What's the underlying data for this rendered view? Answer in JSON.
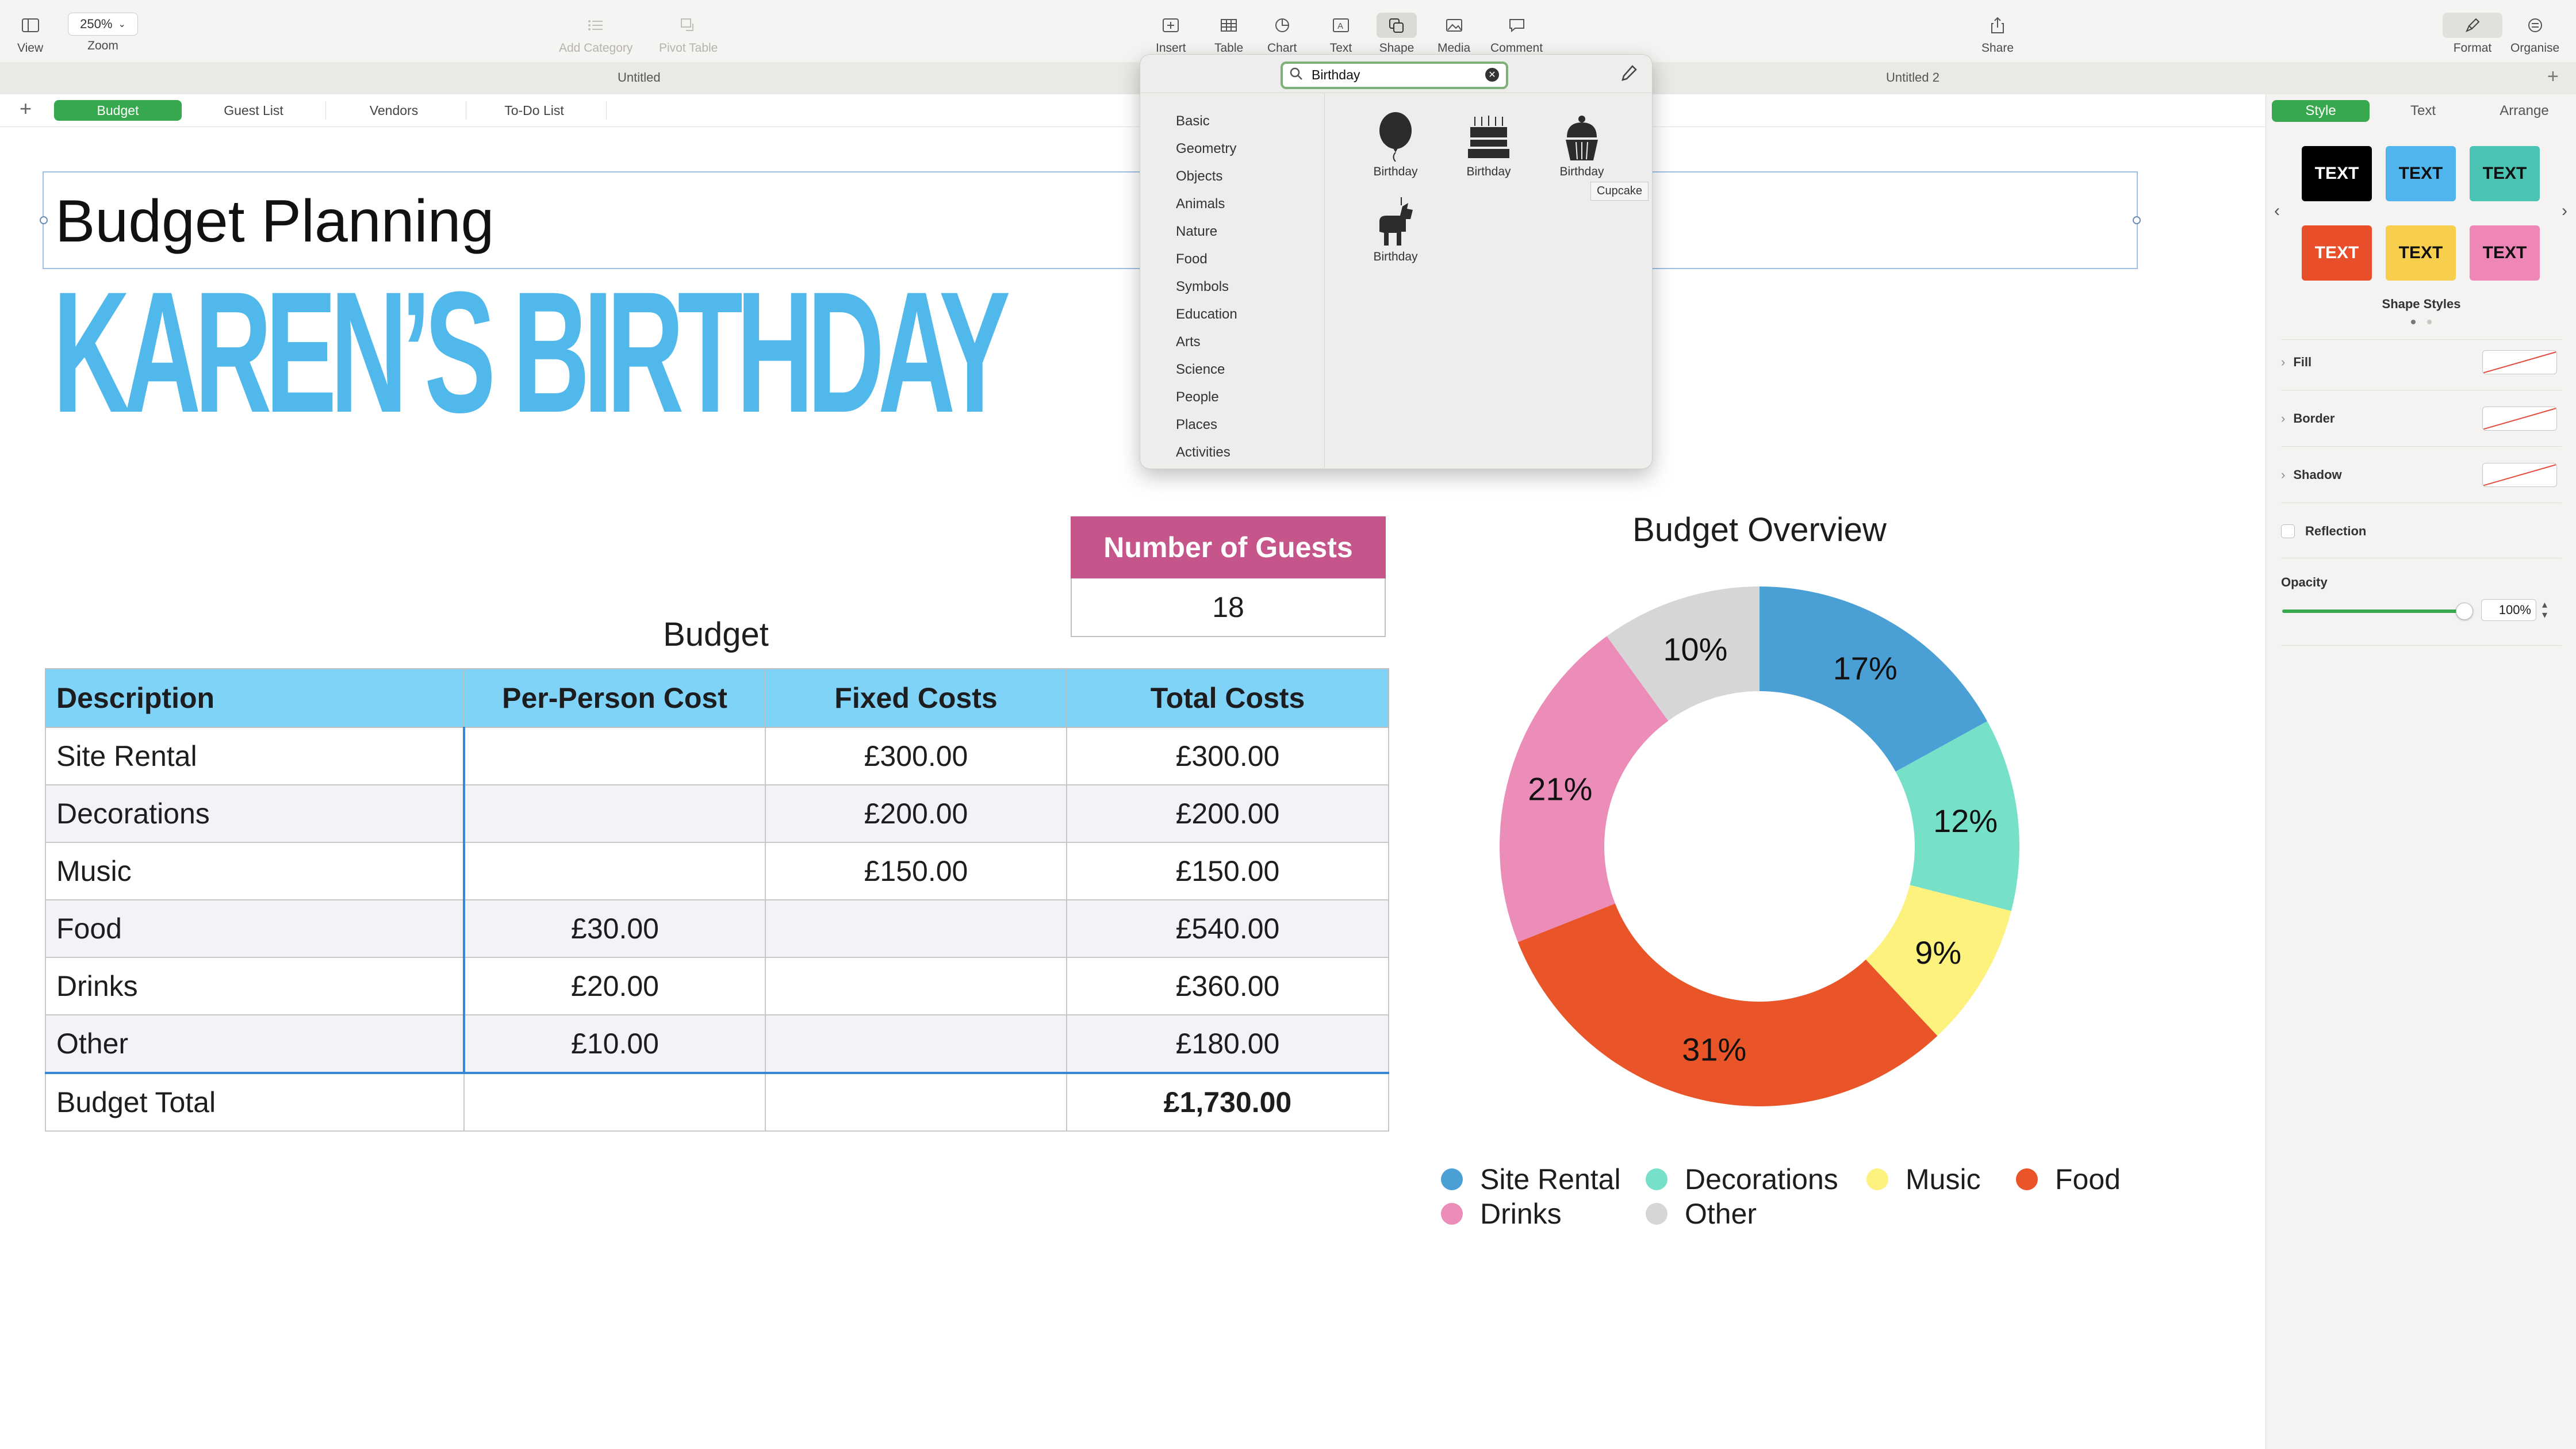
{
  "toolbar": {
    "view_label": "View",
    "zoom_value": "250%",
    "zoom_label": "Zoom",
    "add_category_label": "Add Category",
    "pivot_table_label": "Pivot Table",
    "insert_label": "Insert",
    "table_label": "Table",
    "chart_label": "Chart",
    "text_label": "Text",
    "shape_label": "Shape",
    "media_label": "Media",
    "comment_label": "Comment",
    "share_label": "Share",
    "format_label": "Format",
    "organise_label": "Organise"
  },
  "doc_tabs": {
    "left": "Untitled",
    "right": "Untitled 2"
  },
  "sheets": [
    "Budget",
    "Guest List",
    "Vendors",
    "To-Do List"
  ],
  "canvas": {
    "title": "Budget Planning",
    "banner": "KAREN’S BIRTHDAY",
    "guests_header": "Number of Guests",
    "guests_value": "18",
    "budget_caption": "Budget",
    "chart_title": "Budget Overview"
  },
  "budget_table": {
    "headers": [
      "Description",
      "Per-Person Cost",
      "Fixed Costs",
      "Total Costs"
    ],
    "rows": [
      [
        "Site Rental",
        "",
        "£300.00",
        "£300.00"
      ],
      [
        "Decorations",
        "",
        "£200.00",
        "£200.00"
      ],
      [
        "Music",
        "",
        "£150.00",
        "£150.00"
      ],
      [
        "Food",
        "£30.00",
        "",
        "£540.00"
      ],
      [
        "Drinks",
        "£20.00",
        "",
        "£360.00"
      ],
      [
        "Other",
        "£10.00",
        "",
        "£180.00"
      ]
    ],
    "total": [
      "Budget Total",
      "",
      "",
      "£1,730.00"
    ]
  },
  "chart_data": {
    "type": "pie",
    "title": "Budget Overview",
    "categories": [
      "Site Rental",
      "Decorations",
      "Music",
      "Food",
      "Drinks",
      "Other"
    ],
    "values": [
      17,
      12,
      9,
      31,
      21,
      10
    ],
    "labels": [
      "17%",
      "12%",
      "9%",
      "31%",
      "21%",
      "10%"
    ],
    "colors": [
      "#4aa0d5",
      "#77e0c8",
      "#fcf27d",
      "#e95429",
      "#ec8cb9",
      "#d6d6d6"
    ],
    "legend_position": "bottom"
  },
  "popover": {
    "search_value": "Birthday",
    "categories": [
      "Basic",
      "Geometry",
      "Objects",
      "Animals",
      "Nature",
      "Food",
      "Symbols",
      "Education",
      "Arts",
      "Science",
      "People",
      "Places",
      "Activities"
    ],
    "shapes": [
      {
        "label": "Birthday",
        "icon": "balloon-icon"
      },
      {
        "label": "Birthday",
        "icon": "birthday-cake-icon"
      },
      {
        "label": "Birthday",
        "icon": "cupcake-icon"
      },
      {
        "label": "Birthday",
        "icon": "pinata-icon"
      }
    ],
    "tooltip": "Cupcake"
  },
  "sidebar": {
    "tabs": [
      "Style",
      "Text",
      "Arrange"
    ],
    "style_buttons": [
      {
        "label": "TEXT",
        "bg": "#000000",
        "fg": "#ffffff"
      },
      {
        "label": "TEXT",
        "bg": "#4fb5ec",
        "fg": "#111111"
      },
      {
        "label": "TEXT",
        "bg": "#4cc4b4",
        "fg": "#111111"
      },
      {
        "label": "TEXT",
        "bg": "#e94e2b",
        "fg": "#ffffff"
      },
      {
        "label": "TEXT",
        "bg": "#f8ce4d",
        "fg": "#111111"
      },
      {
        "label": "TEXT",
        "bg": "#ee86b8",
        "fg": "#111111"
      }
    ],
    "shape_styles_label": "Shape Styles",
    "fill_label": "Fill",
    "border_label": "Border",
    "shadow_label": "Shadow",
    "reflection_label": "Reflection",
    "opacity_label": "Opacity",
    "opacity_value": "100%",
    "opacity_level": 1.0
  }
}
